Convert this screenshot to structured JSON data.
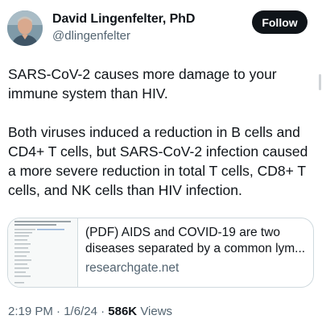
{
  "author": {
    "name": "David Lingenfelter, PhD",
    "handle": "@dlingenfelter"
  },
  "follow_button": {
    "label": "Follow"
  },
  "tweet": {
    "paragraphs": [
      "SARS-CoV-2 causes more damage to your immune system than HIV.",
      "Both viruses induced a reduction in B cells and CD4+ T cells, but SARS-CoV-2 infection caused a more severe reduction in total T cells, CD8+ T cells, and NK cells than HIV infection."
    ]
  },
  "link_card": {
    "title_line1": "(PDF) AIDS and COVID-19 are two",
    "title_line2": "diseases separated by a common lym...",
    "domain": "researchgate.net"
  },
  "meta": {
    "time": "2:19 PM",
    "date": "1/6/24",
    "views_count": "586K",
    "views_label": "Views",
    "separator": "·"
  },
  "colors": {
    "text": "#0f1419",
    "secondary": "#536471",
    "border": "#cfd9de",
    "button_bg": "#0f1419"
  }
}
